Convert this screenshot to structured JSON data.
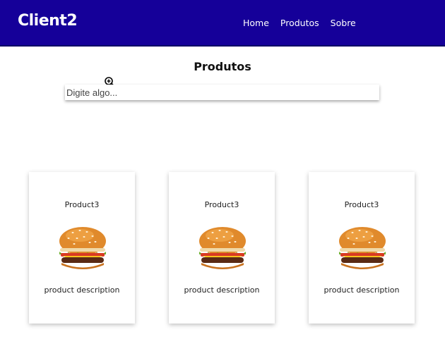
{
  "app": {
    "brand": "Client2"
  },
  "nav": {
    "items": [
      {
        "label": "Home"
      },
      {
        "label": "Produtos"
      },
      {
        "label": "Sobre"
      }
    ]
  },
  "page": {
    "title": "Produtos"
  },
  "search": {
    "placeholder": "Digite algo...",
    "value": ""
  },
  "products": [
    {
      "name": "Product3",
      "description": "product description",
      "image_icon": "hamburger-icon"
    },
    {
      "name": "Product3",
      "description": "product description",
      "image_icon": "hamburger-icon"
    },
    {
      "name": "Product3",
      "description": "product description",
      "image_icon": "hamburger-icon"
    }
  ],
  "colors": {
    "navbar_bg": "#150099",
    "navbar_text": "#ffffff"
  }
}
